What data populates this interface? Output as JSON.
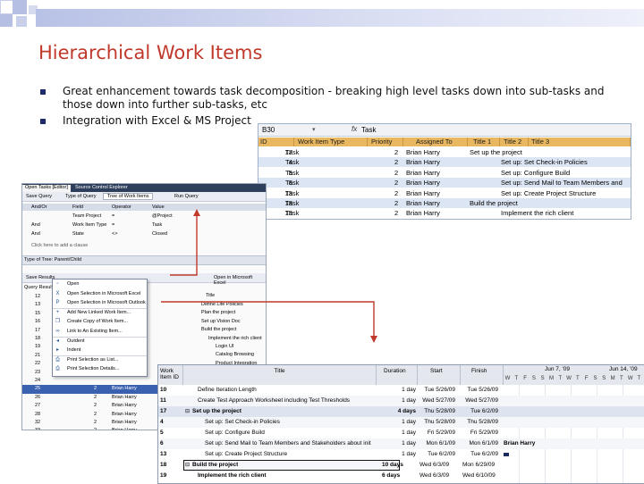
{
  "slide": {
    "title": "Hierarchical Work Items",
    "bullets": [
      "Great enhancement towards task decomposition - breaking high level tasks down into sub-tasks and those down into further sub-tasks, etc",
      "Integration with Excel & MS Project"
    ],
    "accent": "#c0392b"
  },
  "excel": {
    "cell_ref": "B30",
    "fx": "fx",
    "formula_value": "Task",
    "headers": [
      "ID",
      "Work Item Type",
      "Priority",
      "Assigned To",
      "Title 1",
      "Title 2",
      "Title 3"
    ],
    "rows": [
      {
        "id": "17",
        "type": "Task",
        "priority": "2",
        "assigned": "Brian Harry",
        "t1": "Set up the project",
        "t2": ""
      },
      {
        "id": "4",
        "type": "Task",
        "priority": "2",
        "assigned": "Brian Harry",
        "t1": "",
        "t2": "Set up: Set Check-in Policies"
      },
      {
        "id": "5",
        "type": "Task",
        "priority": "2",
        "assigned": "Brian Harry",
        "t1": "",
        "t2": "Set up: Configure Build"
      },
      {
        "id": "6",
        "type": "Task",
        "priority": "2",
        "assigned": "Brian Harry",
        "t1": "",
        "t2": "Set up: Send Mail to Team Members and"
      },
      {
        "id": "13",
        "type": "Task",
        "priority": "2",
        "assigned": "Brian Harry",
        "t1": "",
        "t2": "Set up: Create Project Structure"
      },
      {
        "id": "18",
        "type": "Task",
        "priority": "2",
        "assigned": "Brian Harry",
        "t1": "Build the project",
        "t2": ""
      },
      {
        "id": "19",
        "type": "Task",
        "priority": "2",
        "assigned": "Brian Harry",
        "t1": "",
        "t2": "Implement the rich client"
      }
    ]
  },
  "query": {
    "tabs": [
      "Open Tasks [Editor]",
      "Source Control Explorer"
    ],
    "toolbar": [
      "Save Query",
      "Type of Query",
      "Tree of Work Items",
      "Run Query"
    ],
    "clause_headers": [
      "And/Or",
      "Field",
      "Operator",
      "Value"
    ],
    "clauses": [
      {
        "andor": "",
        "field": "Team Project",
        "op": "=",
        "value": "@Project"
      },
      {
        "andor": "And",
        "field": "Work Item Type",
        "op": "=",
        "value": "Task"
      },
      {
        "andor": "And",
        "field": "State",
        "op": "<>",
        "value": "Closed"
      }
    ],
    "add_clause": "Click here to add a clause",
    "tree_type": "Type of Tree: Parent/Child",
    "results_toolbar": [
      "Save Results",
      "Open in Microsoft Excel"
    ],
    "results_header": "Query Results:",
    "results_col_title": "Title",
    "result_ids": [
      "12",
      "13",
      "15",
      "16",
      "17",
      "18",
      "19",
      "21",
      "22",
      "23",
      "24",
      "25",
      "26",
      "27",
      "28",
      "32",
      "33"
    ],
    "result_titles": [
      "Define Life Policies",
      "Plan the project",
      "Set up Vision Doc",
      "Build the project",
      "Implement the rich client",
      "Login UI",
      "Catalog Browsing",
      "Product Integration"
    ],
    "result_rows": [
      {
        "id": "25",
        "prio": "2",
        "assigned": "Brian Harry"
      },
      {
        "id": "26",
        "prio": "2",
        "assigned": "Brian Harry"
      },
      {
        "id": "27",
        "prio": "2",
        "assigned": "Brian Harry"
      },
      {
        "id": "28",
        "prio": "2",
        "assigned": "Brian Harry"
      },
      {
        "id": "32",
        "prio": "2",
        "assigned": "Brian Harry"
      },
      {
        "id": "33",
        "prio": "2",
        "assigned": "Brian Harry"
      }
    ]
  },
  "context_menu": [
    {
      "icon": "open-icon",
      "label": "Open"
    },
    {
      "icon": "excel-icon",
      "label": "Open Selection in Microsoft Excel"
    },
    {
      "icon": "project-icon",
      "label": "Open Selection in Microsoft Outlook"
    },
    {
      "icon": "add-icon",
      "label": "Add New Linked Work Item..."
    },
    {
      "icon": "copy-icon",
      "label": "Create Copy of Work Item..."
    },
    {
      "icon": "link-icon",
      "label": "Link to An Existing Item..."
    },
    {
      "icon": "outdent-icon",
      "label": "Outdent"
    },
    {
      "icon": "indent-icon",
      "label": "Indent"
    },
    {
      "icon": "print-icon",
      "label": "Print Selection as List..."
    },
    {
      "icon": "print-icon",
      "label": "Print Selection Details..."
    }
  ],
  "project": {
    "headers": {
      "id": "Work Item ID",
      "title": "Title",
      "duration": "Duration",
      "start": "Start",
      "finish": "Finish"
    },
    "week1": "Jun 7, '09",
    "week2": "Jun 14, '09",
    "days": [
      "W",
      "T",
      "F",
      "S",
      "S",
      "M",
      "T",
      "W",
      "T",
      "F",
      "S",
      "S",
      "M",
      "T",
      "W",
      "T"
    ],
    "gantt_label": "Brian Harry",
    "rows": [
      {
        "id": "10",
        "title": "Define Iteration Length",
        "dur": "1 day",
        "start": "Tue 5/26/09",
        "finish": "Tue 5/26/09",
        "lvl": 1,
        "bold": false
      },
      {
        "id": "11",
        "title": "Create Test Approach Worksheet including Test Thresholds",
        "dur": "1 day",
        "start": "Wed 5/27/09",
        "finish": "Wed 5/27/09",
        "lvl": 1,
        "bold": false
      },
      {
        "id": "17",
        "title": "Set up the project",
        "dur": "4 days",
        "start": "Thu 5/28/09",
        "finish": "Tue 6/2/09",
        "lvl": 0,
        "bold": true
      },
      {
        "id": "4",
        "title": "Set up: Set Check-in Policies",
        "dur": "1 day",
        "start": "Thu 5/28/09",
        "finish": "Thu 5/28/09",
        "lvl": 2,
        "bold": false
      },
      {
        "id": "5",
        "title": "Set up: Configure Build",
        "dur": "1 day",
        "start": "Fri 5/29/09",
        "finish": "Fri 5/29/09",
        "lvl": 2,
        "bold": false
      },
      {
        "id": "6",
        "title": "Set up: Send Mail to Team Members and Stakeholders about init",
        "dur": "1 day",
        "start": "Mon 6/1/09",
        "finish": "Mon 6/1/09",
        "lvl": 2,
        "bold": false
      },
      {
        "id": "13",
        "title": "Set up: Create Project Structure",
        "dur": "1 day",
        "start": "Tue 6/2/09",
        "finish": "Tue 6/2/09",
        "lvl": 2,
        "bold": false
      },
      {
        "id": "18",
        "title": "Build the project",
        "dur": "10 days",
        "start": "Wed 6/3/09",
        "finish": "Mon 6/29/09",
        "lvl": 0,
        "bold": true
      },
      {
        "id": "19",
        "title": "Implement the rich client",
        "dur": "6 days",
        "start": "Wed 6/3/09",
        "finish": "Wed 6/10/09",
        "lvl": 1,
        "bold": true
      }
    ]
  }
}
